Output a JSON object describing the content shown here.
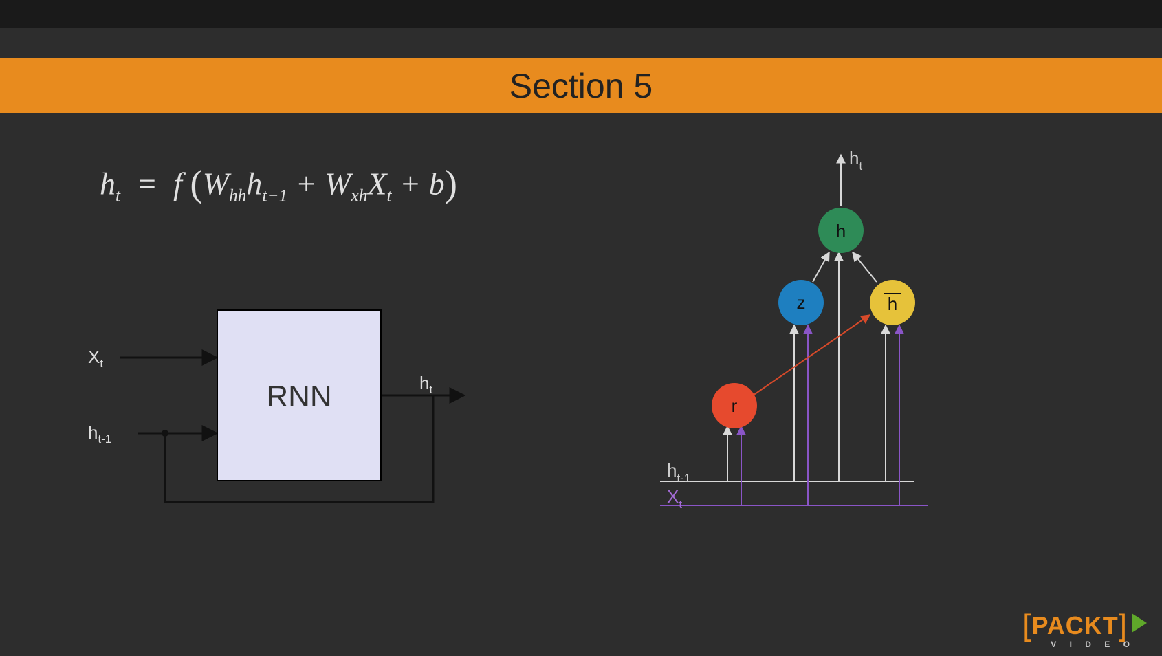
{
  "header": {
    "section_title": "Section 5"
  },
  "equation": {
    "lhs_var": "h",
    "lhs_sub": "t",
    "func": "f",
    "W1": "W",
    "W1_sub": "hh",
    "h_prev": "h",
    "h_prev_sub": "t−1",
    "plus1": "+",
    "W2": "W",
    "W2_sub": "xh",
    "X": "X",
    "X_sub": "t",
    "plus2": "+",
    "b": "b"
  },
  "rnn": {
    "block_label": "RNN",
    "input_x": "X",
    "input_x_sub": "t",
    "input_hprev": "h",
    "input_hprev_sub": "t-1",
    "output_h": "h",
    "output_h_sub": "t"
  },
  "gru": {
    "output_label": "h",
    "output_sub": "t",
    "node_h": "h",
    "node_z": "z",
    "node_hbar": "h",
    "node_hbar_overline": true,
    "node_r": "r",
    "axis_hprev": "h",
    "axis_hprev_sub": "t-1",
    "axis_x": "X",
    "axis_x_sub": "t",
    "colors": {
      "h": "#2e8b57",
      "z": "#1e7fc0",
      "hbar": "#e6c23a",
      "r": "#e64a2e",
      "hprev_line": "#d8d8d8",
      "x_line": "#8a55c7",
      "r_to_hbar": "#d84a2a"
    }
  },
  "branding": {
    "name": "PACKT",
    "subline": "V I D E O"
  }
}
